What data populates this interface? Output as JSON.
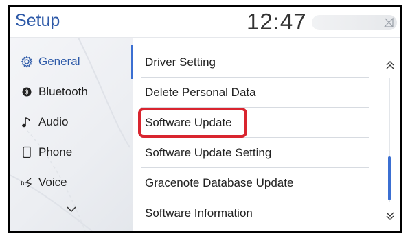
{
  "header": {
    "title": "Setup",
    "clock": "12:47"
  },
  "sidebar": {
    "items": [
      {
        "label": "General",
        "icon": "gear-icon",
        "active": true
      },
      {
        "label": "Bluetooth",
        "icon": "bluetooth-icon",
        "active": false
      },
      {
        "label": "Audio",
        "icon": "music-note-icon",
        "active": false
      },
      {
        "label": "Phone",
        "icon": "phone-icon",
        "active": false
      },
      {
        "label": "Voice",
        "icon": "voice-icon",
        "active": false
      }
    ],
    "more_icon": "chevron-down-icon"
  },
  "list": {
    "items": [
      "Driver Setting",
      "Delete Personal Data",
      "Software Update",
      "Software Update Setting",
      "Gracenote Database Update",
      "Software Information"
    ],
    "highlighted": "Software Update"
  },
  "colors": {
    "accent": "#3b6fd2",
    "title": "#2e5aa8",
    "highlight": "#d9252f"
  },
  "scroll": {
    "up_icon": "double-chevron-up-icon",
    "down_icon": "double-chevron-down-icon"
  }
}
